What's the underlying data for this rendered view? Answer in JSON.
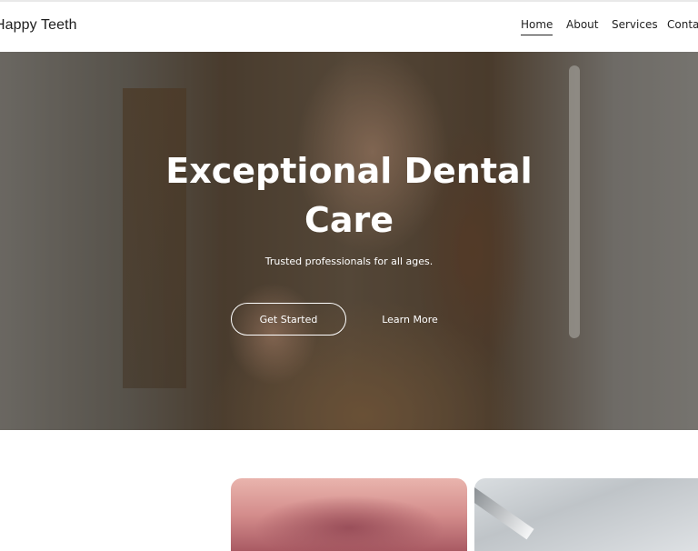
{
  "brand": {
    "name": "Happy Teeth"
  },
  "nav": {
    "items": [
      {
        "label": "Home",
        "active": true
      },
      {
        "label": "About",
        "active": false
      },
      {
        "label": "Services",
        "active": false
      },
      {
        "label": "Contact",
        "active": false
      }
    ]
  },
  "hero": {
    "title": "Exceptional Dental Care",
    "subtitle": "Trusted professionals for all ages.",
    "primary_button": "Get Started",
    "secondary_button": "Learn More",
    "image": "woman-holding-cheek-toothache-photo"
  },
  "cards": [
    {
      "image": "smile-closeup-photo"
    },
    {
      "image": "dental-office-ceiling-photo"
    }
  ],
  "colors": {
    "text_dark": "#222222",
    "hero_text": "#ffffff",
    "header_bg": "#ffffff"
  }
}
